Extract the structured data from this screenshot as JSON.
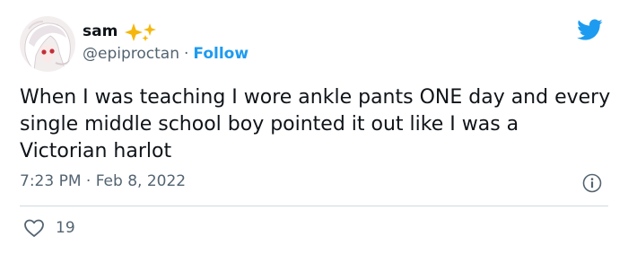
{
  "user": {
    "display_name": "sam",
    "handle": "@epiproctan",
    "separator": "·",
    "follow_label": "Follow"
  },
  "tweet": {
    "text": "When I was teaching I wore ankle pants ONE day and every single middle school boy pointed it out like I was a Victorian harlot",
    "timestamp": "7:23 PM · Feb 8, 2022"
  },
  "engagement": {
    "likes": "19"
  },
  "icons": {
    "brand": "twitter-bird-icon",
    "info": "info-icon",
    "like": "heart-icon",
    "decoration": "sparkles-icon"
  },
  "colors": {
    "brand": "#1d9bf0",
    "text": "#0f1419",
    "secondary": "#536471",
    "sparkle": "#f5b70c",
    "divider": "#cfd9de"
  }
}
